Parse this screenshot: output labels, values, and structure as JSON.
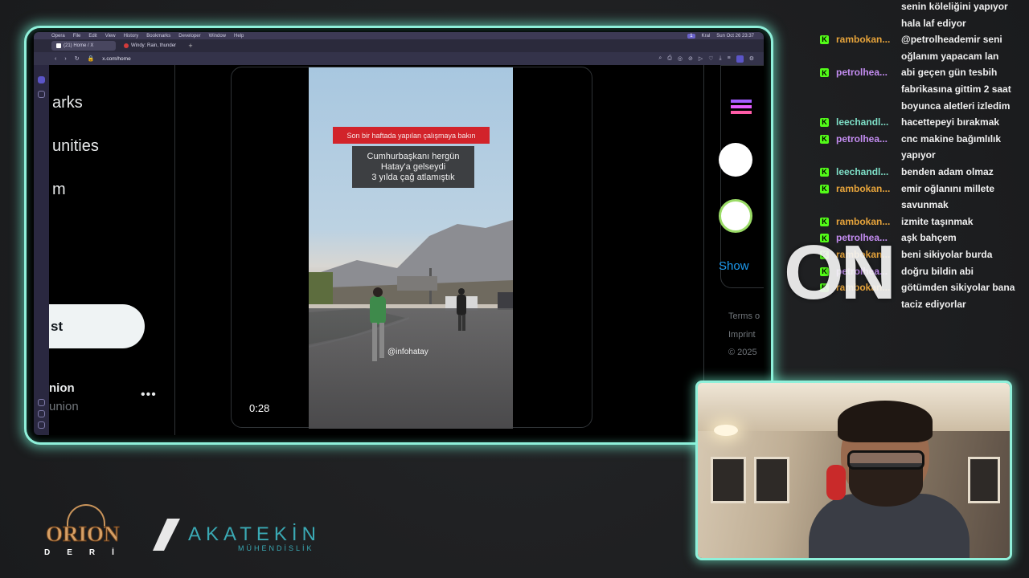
{
  "menubar": {
    "items": [
      "Opera",
      "File",
      "Edit",
      "View",
      "History",
      "Bookmarks",
      "Developer",
      "Window",
      "Help"
    ],
    "status": [
      "1",
      "Kral",
      "Sun Oct 26  23:37"
    ]
  },
  "browser": {
    "tabs": [
      {
        "label": "(21) Home / X",
        "icon_color": "#ffffff"
      },
      {
        "label": "Windy: Rain, thunder",
        "icon_color": "#d23b3b"
      }
    ],
    "url": "x.com/home"
  },
  "x_nav": {
    "items": [
      "arks",
      "unities",
      "m"
    ],
    "post_button": "st",
    "account_name": "nion",
    "account_handle": "union",
    "more": "•••"
  },
  "video": {
    "banner": "Son bir haftada yapılan çalışmaya bakın",
    "caption_lines": [
      "Cumhurbaşkanı hergün",
      "Hatay'a gelseydi",
      "3 yılda çağ atlamıştık"
    ],
    "watermark": "@infohatay",
    "time": "0:28"
  },
  "right_column": {
    "show_more": "Show",
    "footer": [
      "Terms o",
      "Imprint",
      "© 2025"
    ]
  },
  "chat": [
    {
      "user": "",
      "message": "senin köleliğini yapıyor hala laf ediyor",
      "color": "#e7a43b"
    },
    {
      "user": "rambokan...",
      "message": "@petrolheademir seni oğlanım yapacam lan",
      "color": "#e7a43b"
    },
    {
      "user": "petrolhea...",
      "message": "abi geçen gün tesbih fabrikasına gittim 2 saat boyunca aletleri izledim",
      "color": "#c38cf0"
    },
    {
      "user": "leechandl...",
      "message": "hacettepeyi bırakmak",
      "color": "#7fe0c8"
    },
    {
      "user": "petrolhea...",
      "message": "cnc makine bağımlılık yapıyor",
      "color": "#c38cf0"
    },
    {
      "user": "leechandl...",
      "message": "benden adam olmaz",
      "color": "#7fe0c8"
    },
    {
      "user": "rambokan...",
      "message": "emir oğlanını millete savunmak",
      "color": "#e7a43b"
    },
    {
      "user": "rambokan...",
      "message": "izmite taşınmak",
      "color": "#e7a43b"
    },
    {
      "user": "petrolhea...",
      "message": "aşk bahçem",
      "color": "#c38cf0"
    },
    {
      "user": "rambokan...",
      "message": "beni sikiyolar burda",
      "color": "#e7a43b"
    },
    {
      "user": "petrolhea...",
      "message": "doğru bildin abi",
      "color": "#c38cf0"
    },
    {
      "user": "rambokan...",
      "message": "götümden sikiyolar bana taciz ediyorlar",
      "color": "#e7a43b"
    }
  ],
  "chat_badge": "K",
  "overlay_text": "ON",
  "sponsors": {
    "orion": {
      "name": "ORION",
      "sub": "DERİ"
    },
    "akatekin": {
      "name": "AKATEKİN",
      "sub": "MÜHENDİSLİK"
    }
  }
}
